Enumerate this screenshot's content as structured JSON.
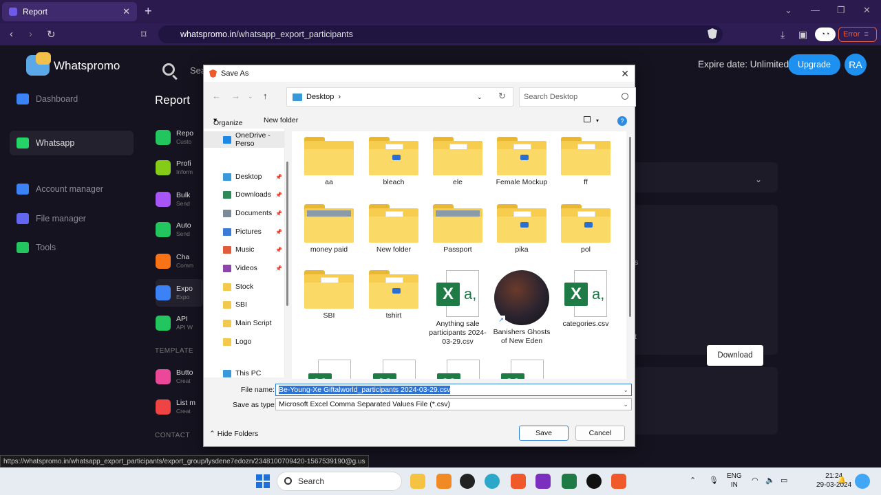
{
  "browser": {
    "tab_title": "Report",
    "url_domain": "whatspromo.in",
    "url_path": "/whatsapp_export_participants",
    "error_label": "Error"
  },
  "app": {
    "logo_text": "Whatspromo",
    "search_placeholder": "Sea",
    "expire_text": "Expire date: Unlimited",
    "upgrade_label": "Upgrade",
    "avatar_initials": "RA",
    "sidebar": [
      {
        "label": "Dashboard",
        "icon": "home-icon",
        "color": "#3b82f6"
      },
      {
        "label": "Whatsapp",
        "icon": "whatsapp-icon",
        "color": "#25d366"
      },
      {
        "label": "Account manager",
        "icon": "share-icon",
        "color": "#3b82f6"
      },
      {
        "label": "File manager",
        "icon": "folder-icon",
        "color": "#6366f1"
      },
      {
        "label": "Tools",
        "icon": "tools-icon",
        "color": "#22c55e"
      }
    ],
    "report_heading": "Report",
    "report_items": [
      {
        "title": "Repo",
        "sub": "Custo",
        "color": "#22c55e"
      },
      {
        "title": "Profi",
        "sub": "Inform",
        "color": "#84cc16"
      },
      {
        "title": "Bulk",
        "sub": "Send",
        "color": "#a855f7"
      },
      {
        "title": "Auto",
        "sub": "Send",
        "color": "#22c55e"
      },
      {
        "title": "Cha",
        "sub": "Comm",
        "color": "#f97316"
      },
      {
        "title": "Expo",
        "sub": "Expo",
        "color": "#3b82f6"
      },
      {
        "title": "API",
        "sub": "API W",
        "color": "#22c55e"
      }
    ],
    "template_label": "TEMPLATE",
    "template_items": [
      {
        "title": "Butto",
        "sub": "Creat",
        "color": "#ec4899"
      },
      {
        "title": "List m",
        "sub": "Creat",
        "color": "#ef4444"
      }
    ],
    "contact_label": "CONTACT",
    "bg_fragments": [
      "s",
      "t"
    ],
    "download_label": "Download"
  },
  "dialog": {
    "title": "Save As",
    "breadcrumb": "Desktop",
    "search_placeholder": "Search Desktop",
    "organize": "Organize",
    "new_folder": "New folder",
    "nav": [
      {
        "label": "OneDrive - Perso",
        "icon": "onedrive-icon",
        "color": "#1e88e5",
        "pinned": false
      },
      {
        "label": "Desktop",
        "icon": "desktop-icon",
        "color": "#3a9ad9",
        "pinned": true
      },
      {
        "label": "Downloads",
        "icon": "download-icon",
        "color": "#2e8b57",
        "pinned": true
      },
      {
        "label": "Documents",
        "icon": "documents-icon",
        "color": "#7a8a99",
        "pinned": true
      },
      {
        "label": "Pictures",
        "icon": "pictures-icon",
        "color": "#3a7bd5",
        "pinned": true
      },
      {
        "label": "Music",
        "icon": "music-icon",
        "color": "#e25b3a",
        "pinned": true
      },
      {
        "label": "Videos",
        "icon": "videos-icon",
        "color": "#8e44ad",
        "pinned": true
      },
      {
        "label": "Stock",
        "icon": "folder-icon",
        "color": "#f2c94c",
        "pinned": false
      },
      {
        "label": "SBI",
        "icon": "folder-icon",
        "color": "#f2c94c",
        "pinned": false
      },
      {
        "label": "Main Script",
        "icon": "folder-icon",
        "color": "#f2c94c",
        "pinned": false
      },
      {
        "label": "Logo",
        "icon": "folder-icon",
        "color": "#f2c94c",
        "pinned": false
      },
      {
        "label": "This PC",
        "icon": "pc-icon",
        "color": "#3a9ad9",
        "pinned": false
      }
    ],
    "files": [
      {
        "name": "aa",
        "kind": "folder",
        "content": "none"
      },
      {
        "name": "bleach",
        "kind": "folder",
        "content": "badge"
      },
      {
        "name": "ele",
        "kind": "folder",
        "content": "paper"
      },
      {
        "name": "Female Mockup",
        "kind": "folder",
        "content": "badge"
      },
      {
        "name": "ff",
        "kind": "folder",
        "content": "paper"
      },
      {
        "name": "money paid",
        "kind": "folder",
        "content": "image"
      },
      {
        "name": "New folder",
        "kind": "folder",
        "content": "paper"
      },
      {
        "name": "Passport",
        "kind": "folder",
        "content": "image"
      },
      {
        "name": "pika",
        "kind": "folder",
        "content": "badge"
      },
      {
        "name": "pol",
        "kind": "folder",
        "content": "badge"
      },
      {
        "name": "SBI",
        "kind": "folder",
        "content": "paper"
      },
      {
        "name": "tshirt",
        "kind": "folder",
        "content": "badge"
      },
      {
        "name": "Anything sale participants 2024-03-29.csv",
        "kind": "xls"
      },
      {
        "name": "Banishers Ghosts of New Eden",
        "kind": "shortcut"
      },
      {
        "name": "categories.csv",
        "kind": "xls"
      }
    ],
    "file_name_label": "File name:",
    "file_name_value": "Be-Young-Xe Giftalworld_participants 2024-03-29.csv",
    "save_type_label": "Save as type:",
    "save_type_value": "Microsoft Excel Comma Separated Values File (*.csv)",
    "hide_folders": "Hide Folders",
    "save_label": "Save",
    "cancel_label": "Cancel"
  },
  "status_url": "https://whatspromo.in/whatsapp_export_participants/export_group/lysdene7edozn/2348100709420-1567539190@g.us",
  "taskbar": {
    "search_label": "Search",
    "lang_line1": "ENG",
    "lang_line2": "IN",
    "time": "21:24",
    "date": "29-03-2024"
  }
}
